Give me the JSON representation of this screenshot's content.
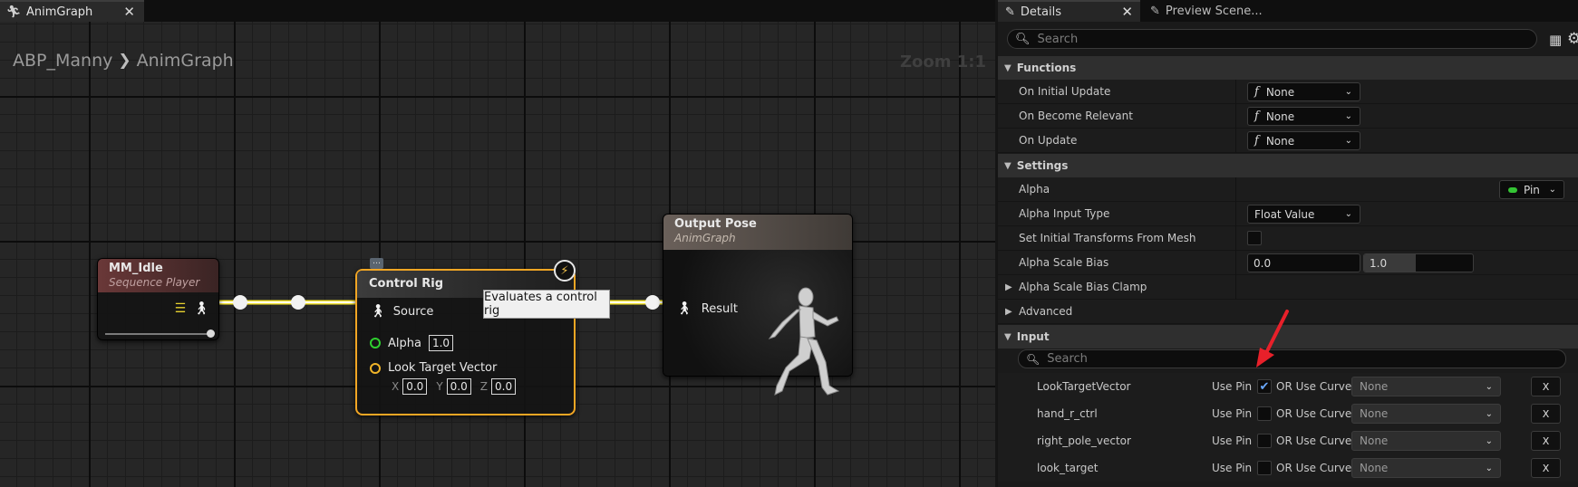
{
  "graph": {
    "tab": {
      "label": "AnimGraph"
    },
    "breadcrumb": {
      "root": "ABP_Manny",
      "leaf": "AnimGraph"
    },
    "zoom": "Zoom 1:1",
    "nodes": {
      "idle": {
        "title": "MM_Idle",
        "subtitle": "Sequence Player",
        "play_position": 1.0
      },
      "control_rig": {
        "title": "Control Rig",
        "source_label": "Source",
        "alpha_label": "Alpha",
        "alpha_value": "1.0",
        "look_label": "Look Target Vector",
        "x_label": "X",
        "x_value": "0.0",
        "y_label": "Y",
        "y_value": "0.0",
        "z_label": "Z",
        "z_value": "0.0"
      },
      "output": {
        "title": "Output Pose",
        "subtitle": "AnimGraph",
        "result_label": "Result"
      }
    },
    "tooltip": "Evaluates a control rig",
    "colors": {
      "exec_wire": "#f2e230",
      "rig_border": "#f2a624",
      "alpha_pin": "#2fd12f",
      "vector_pin": "#f0b428"
    }
  },
  "details": {
    "tabs": {
      "details": "Details",
      "preview": "Preview Scene..."
    },
    "search_placeholder": "Search",
    "sections": {
      "functions": "Functions",
      "settings": "Settings",
      "scale_clamp": "Alpha Scale Bias Clamp",
      "advanced": "Advanced",
      "input": "Input"
    },
    "functions": {
      "initial_update": {
        "label": "On Initial Update",
        "value": "None",
        "fn": "f"
      },
      "become_relevant": {
        "label": "On Become Relevant",
        "value": "None",
        "fn": "f"
      },
      "update": {
        "label": "On Update",
        "value": "None",
        "fn": "f"
      }
    },
    "settings": {
      "alpha": {
        "label": "Alpha",
        "pin": "Pin"
      },
      "alpha_input_type": {
        "label": "Alpha Input Type",
        "value": "Float Value"
      },
      "initial_transforms": {
        "label": "Set Initial Transforms From Mesh",
        "checked": false
      },
      "scale_bias": {
        "label": "Alpha Scale Bias",
        "min": "0.0",
        "max": "1.0"
      }
    },
    "input": {
      "search_placeholder": "Search",
      "use_pin_label": "Use Pin",
      "or_curve_label": "OR Use Curve",
      "clear_label": "X",
      "rows": [
        {
          "name": "LookTargetVector",
          "checked": true,
          "curve": "None"
        },
        {
          "name": "hand_r_ctrl",
          "checked": false,
          "curve": "None"
        },
        {
          "name": "right_pole_vector",
          "checked": false,
          "curve": "None"
        },
        {
          "name": "look_target",
          "checked": false,
          "curve": "None"
        }
      ]
    },
    "colors": {
      "checkbox_check": "#6aa8ff",
      "pin_dot": "#34c434",
      "annotation_arrow": "#e8202a"
    }
  }
}
